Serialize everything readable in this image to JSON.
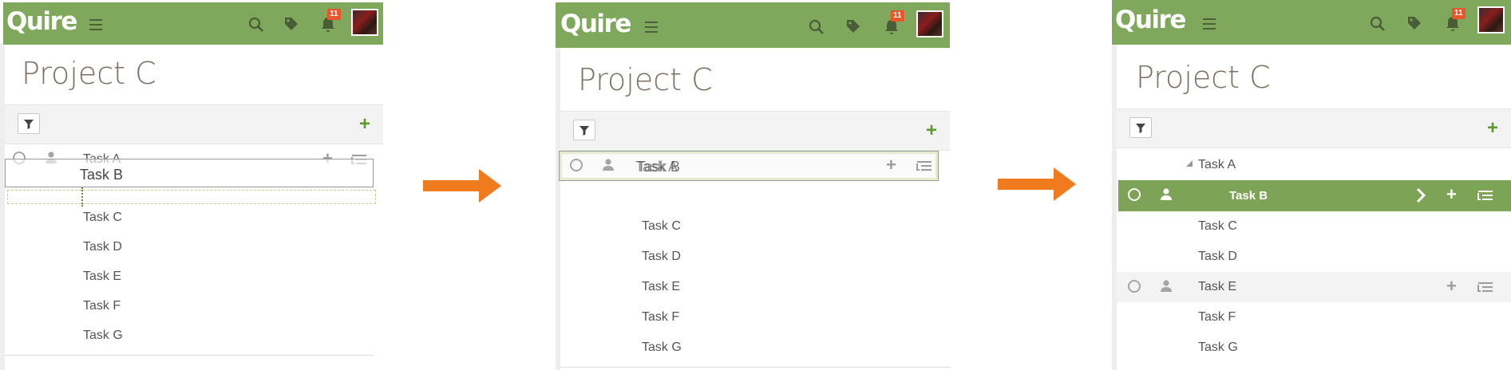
{
  "app": {
    "logo": "Quire",
    "notification_count": "11"
  },
  "project": {
    "title": "Project C"
  },
  "tasks": [
    "Task A",
    "Task B",
    "Task C",
    "Task D",
    "Task E",
    "Task F",
    "Task G"
  ],
  "colors": {
    "brand": "#80a85c",
    "selected_row": "#7ca356",
    "badge": "#e8562a",
    "arrow": "#f07b1f",
    "add_button": "#5e9a2e"
  },
  "icons": [
    "menu-icon",
    "search-icon",
    "tags-icon",
    "bell-icon",
    "filter-icon",
    "add-icon",
    "circle-icon",
    "person-icon",
    "subtask-icon",
    "chevron-right-icon",
    "arrow-right-icon"
  ]
}
